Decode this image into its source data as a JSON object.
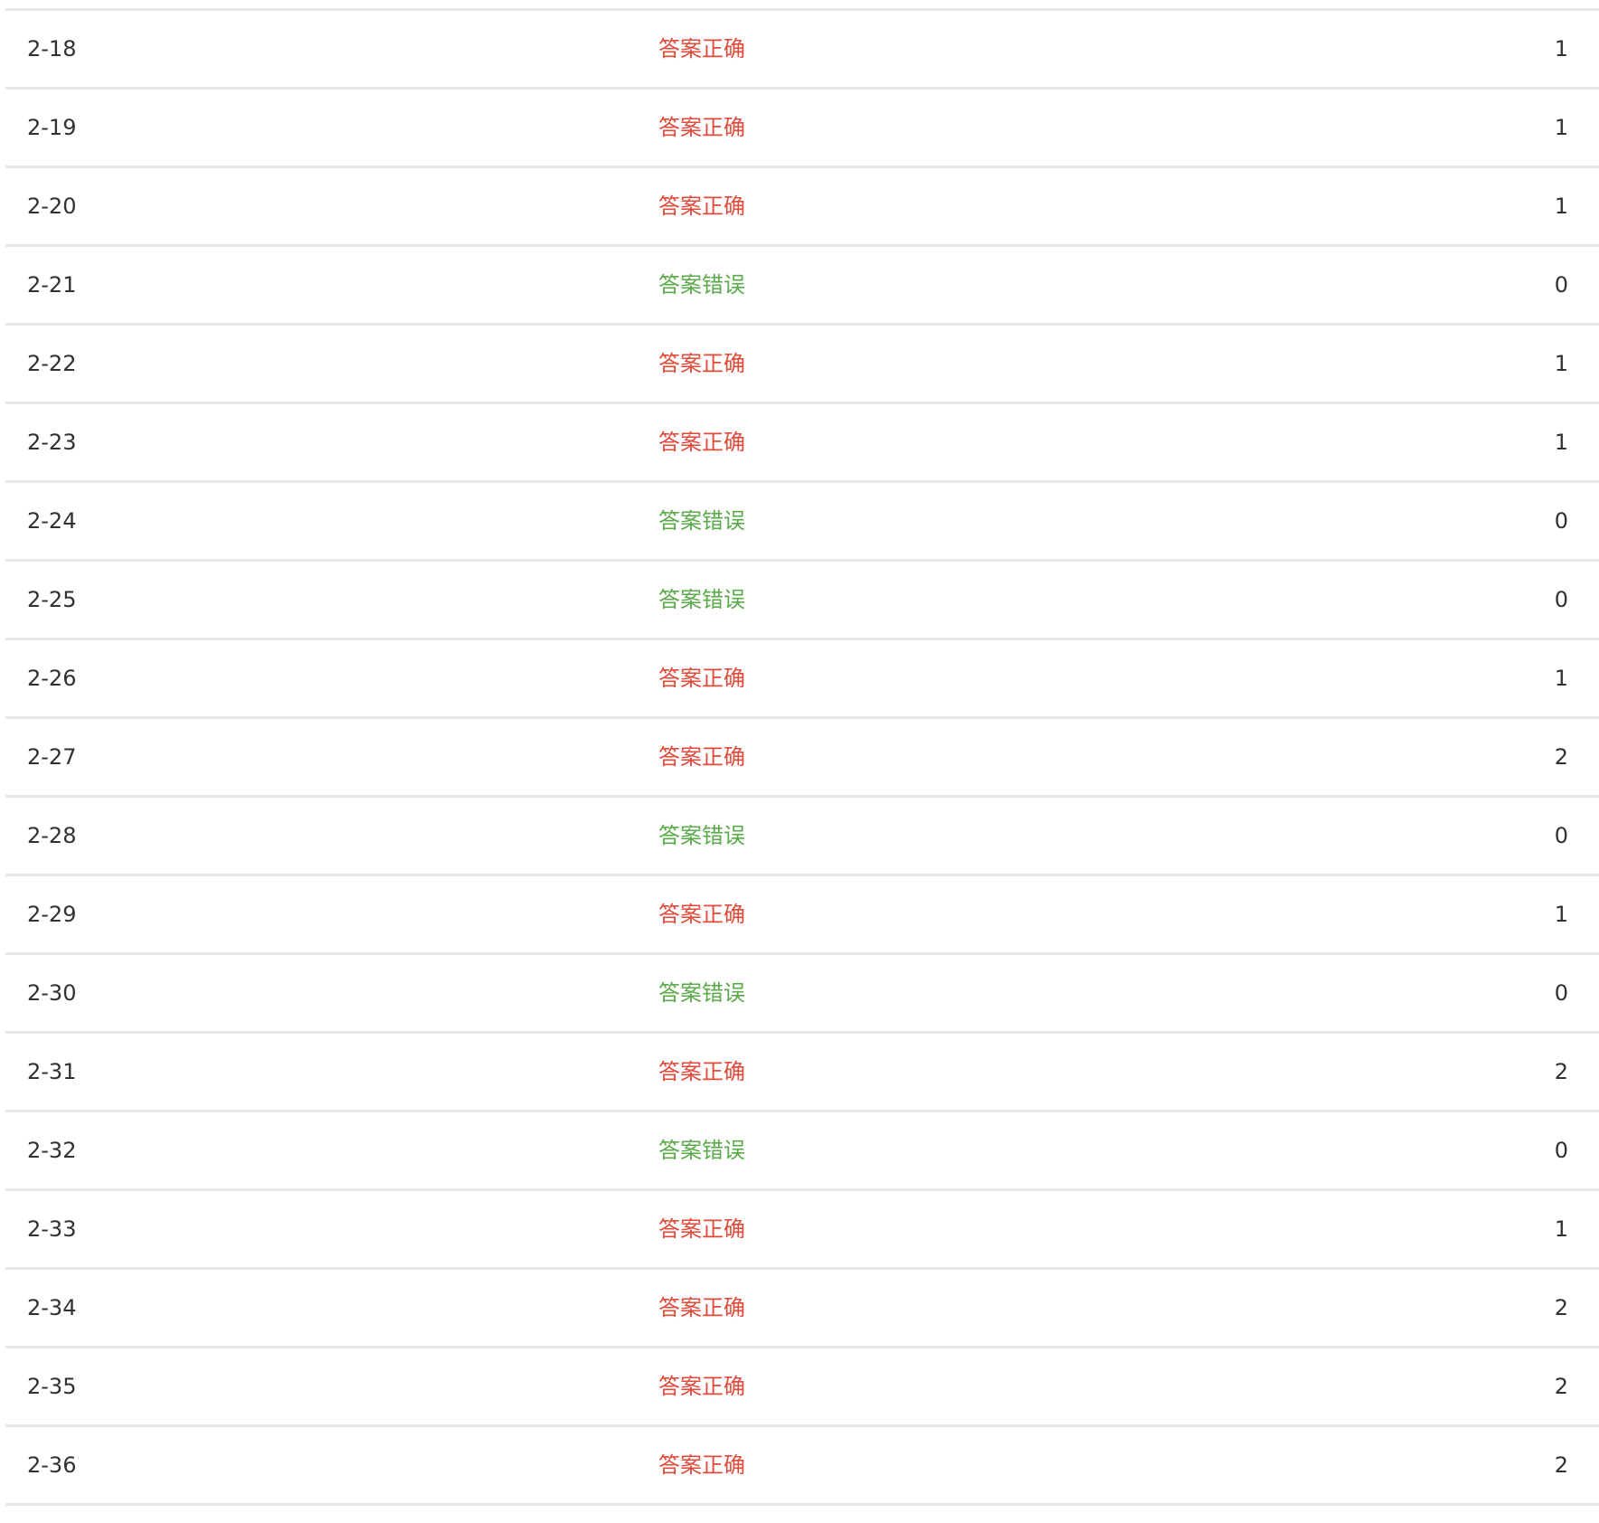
{
  "colors": {
    "correct": "#e04a3a",
    "wrong": "#5aaa4a",
    "text": "#303133",
    "divider": "#e4e6ea"
  },
  "rows": [
    {
      "id": "2-18",
      "status": "答案正确",
      "correct": true,
      "score": "1"
    },
    {
      "id": "2-19",
      "status": "答案正确",
      "correct": true,
      "score": "1"
    },
    {
      "id": "2-20",
      "status": "答案正确",
      "correct": true,
      "score": "1"
    },
    {
      "id": "2-21",
      "status": "答案错误",
      "correct": false,
      "score": "0"
    },
    {
      "id": "2-22",
      "status": "答案正确",
      "correct": true,
      "score": "1"
    },
    {
      "id": "2-23",
      "status": "答案正确",
      "correct": true,
      "score": "1"
    },
    {
      "id": "2-24",
      "status": "答案错误",
      "correct": false,
      "score": "0"
    },
    {
      "id": "2-25",
      "status": "答案错误",
      "correct": false,
      "score": "0"
    },
    {
      "id": "2-26",
      "status": "答案正确",
      "correct": true,
      "score": "1"
    },
    {
      "id": "2-27",
      "status": "答案正确",
      "correct": true,
      "score": "2"
    },
    {
      "id": "2-28",
      "status": "答案错误",
      "correct": false,
      "score": "0"
    },
    {
      "id": "2-29",
      "status": "答案正确",
      "correct": true,
      "score": "1"
    },
    {
      "id": "2-30",
      "status": "答案错误",
      "correct": false,
      "score": "0"
    },
    {
      "id": "2-31",
      "status": "答案正确",
      "correct": true,
      "score": "2"
    },
    {
      "id": "2-32",
      "status": "答案错误",
      "correct": false,
      "score": "0"
    },
    {
      "id": "2-33",
      "status": "答案正确",
      "correct": true,
      "score": "1"
    },
    {
      "id": "2-34",
      "status": "答案正确",
      "correct": true,
      "score": "2"
    },
    {
      "id": "2-35",
      "status": "答案正确",
      "correct": true,
      "score": "2"
    },
    {
      "id": "2-36",
      "status": "答案正确",
      "correct": true,
      "score": "2"
    }
  ]
}
